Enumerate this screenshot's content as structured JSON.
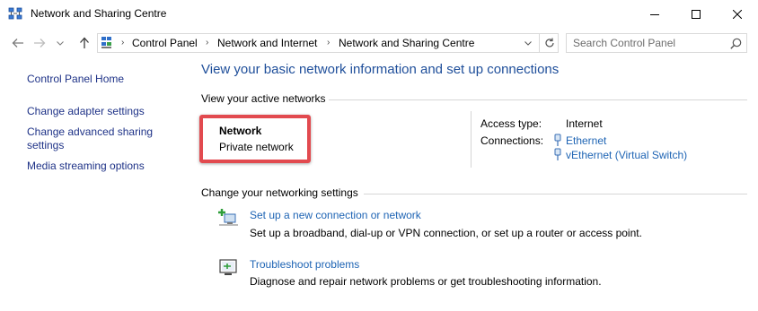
{
  "window": {
    "title": "Network and Sharing Centre"
  },
  "address_bar": {
    "crumbs": [
      "Control Panel",
      "Network and Internet",
      "Network and Sharing Centre"
    ],
    "search_placeholder": "Search Control Panel"
  },
  "sidebar": {
    "items": [
      {
        "label": "Control Panel Home"
      },
      {
        "label": "Change adapter settings"
      },
      {
        "label": "Change advanced sharing settings"
      },
      {
        "label": "Media streaming options"
      }
    ]
  },
  "main": {
    "title": "View your basic network information and set up connections",
    "active_networks_label": "View your active networks",
    "network": {
      "name": "Network",
      "type": "Private network",
      "access_type_label": "Access type:",
      "access_type_value": "Internet",
      "connections_label": "Connections:",
      "connections": [
        "Ethernet",
        "vEthernet (Virtual Switch)"
      ]
    },
    "change_settings_label": "Change your networking settings",
    "tasks": [
      {
        "link": "Set up a new connection or network",
        "description": "Set up a broadband, dial-up or VPN connection, or set up a router or access point."
      },
      {
        "link": "Troubleshoot problems",
        "description": "Diagnose and repair network problems or get troubleshooting information."
      }
    ]
  },
  "colors": {
    "link": "#1e64b4",
    "sidebar_link": "#1e3287",
    "title_blue": "#1e4e9a",
    "highlight_red": "#e24a4f"
  },
  "icons": {
    "app": "network-sharing-icon",
    "back": "back-arrow-icon",
    "forward": "forward-arrow-icon",
    "recent": "recent-locations-chevron-icon",
    "up": "up-arrow-icon",
    "refresh": "refresh-icon",
    "search": "search-icon",
    "connection": "ethernet-connection-icon",
    "new_connection": "new-connection-icon",
    "troubleshoot": "troubleshoot-icon"
  }
}
